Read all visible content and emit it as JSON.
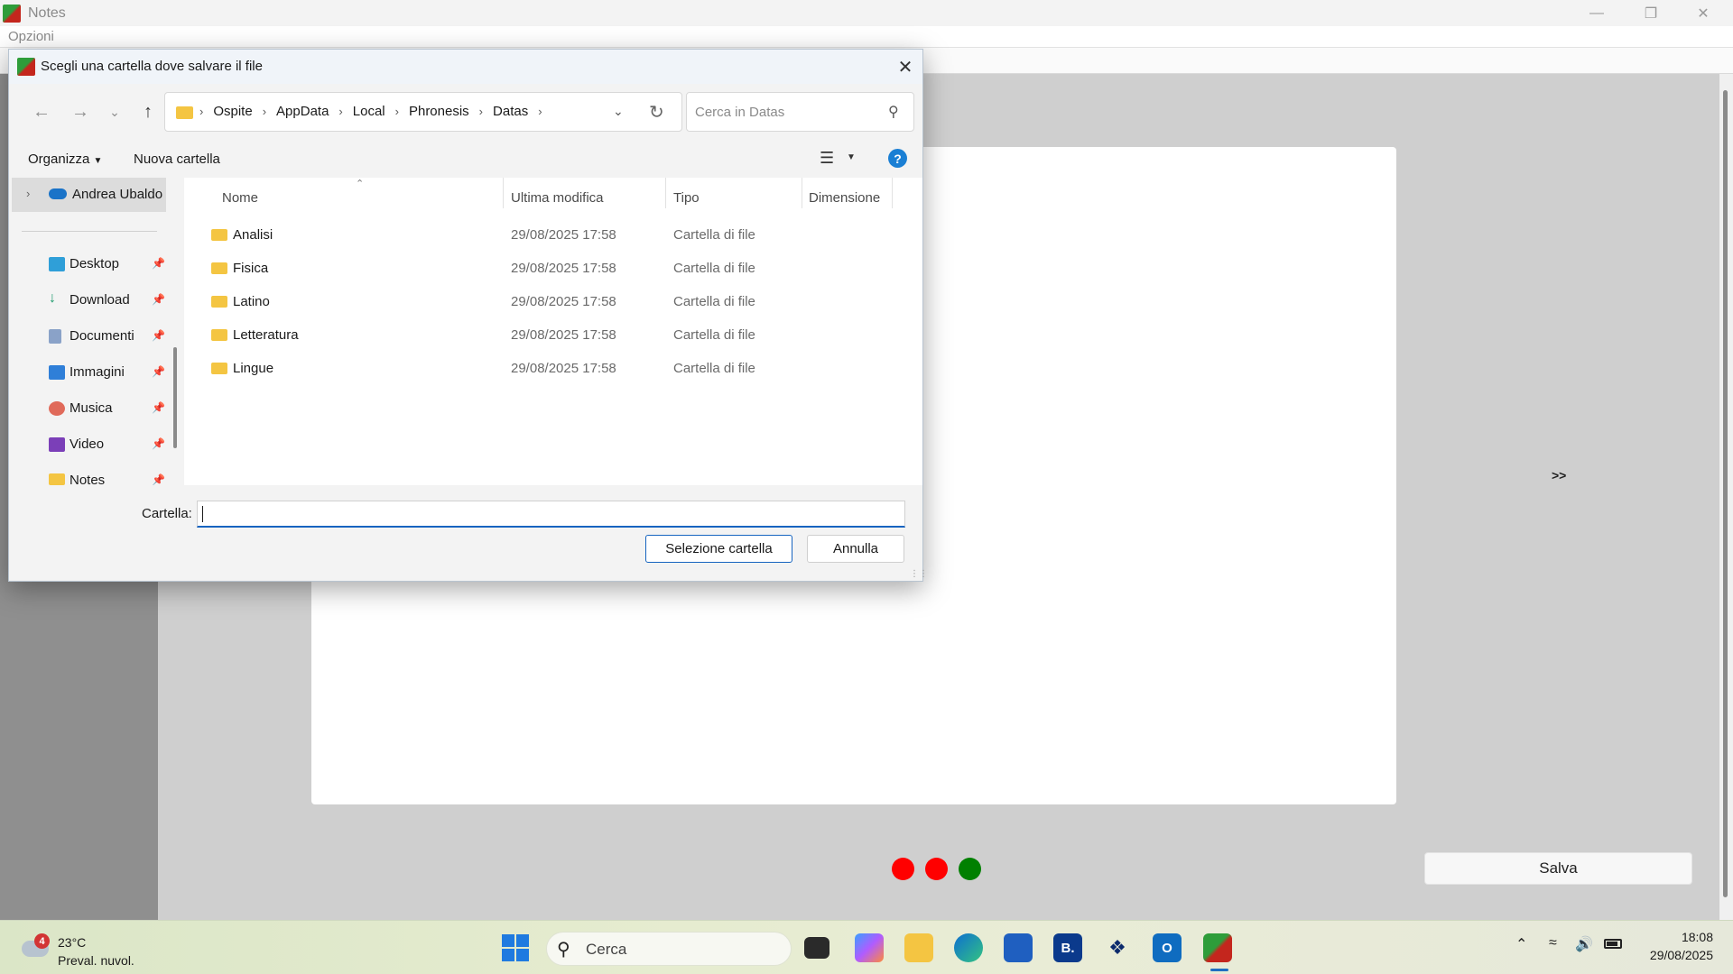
{
  "app": {
    "title": "Notes",
    "menu": [
      "Opzioni"
    ],
    "next_label": ">>",
    "save_label": "Salva",
    "dot_colors": [
      "#ff0000",
      "#ff0000",
      "#008000"
    ]
  },
  "dialog": {
    "title": "Scegli una cartella dove salvare il file",
    "breadcrumb": [
      "Ospite",
      "AppData",
      "Local",
      "Phronesis",
      "Datas"
    ],
    "search_placeholder": "Cerca in Datas",
    "toolbar": {
      "organize": "Organizza",
      "new_folder": "Nuova cartella"
    },
    "nav": {
      "onedrive": "Andrea Ubaldo",
      "items": [
        {
          "label": "Desktop",
          "icon": "desktop-icon"
        },
        {
          "label": "Download",
          "icon": "download-icon"
        },
        {
          "label": "Documenti",
          "icon": "documents-icon"
        },
        {
          "label": "Immagini",
          "icon": "pictures-icon"
        },
        {
          "label": "Musica",
          "icon": "music-icon"
        },
        {
          "label": "Video",
          "icon": "video-icon"
        },
        {
          "label": "Notes",
          "icon": "folder-icon"
        }
      ]
    },
    "columns": [
      "Nome",
      "Ultima modifica",
      "Tipo",
      "Dimensione"
    ],
    "files": [
      {
        "name": "Analisi",
        "modified": "29/08/2025 17:58",
        "type": "Cartella di file"
      },
      {
        "name": "Fisica",
        "modified": "29/08/2025 17:58",
        "type": "Cartella di file"
      },
      {
        "name": "Latino",
        "modified": "29/08/2025 17:58",
        "type": "Cartella di file"
      },
      {
        "name": "Letteratura",
        "modified": "29/08/2025 17:58",
        "type": "Cartella di file"
      },
      {
        "name": "Lingue",
        "modified": "29/08/2025 17:58",
        "type": "Cartella di file"
      }
    ],
    "folder_label": "Cartella:",
    "folder_value": "",
    "select_button": "Selezione cartella",
    "cancel_button": "Annulla"
  },
  "taskbar": {
    "weather": {
      "badge": "4",
      "temp": "23°C",
      "desc": "Preval. nuvol."
    },
    "search_label": "Cerca",
    "apps": [
      "task-view-icon",
      "copilot-icon",
      "file-explorer-icon",
      "edge-icon",
      "store-icon",
      "booking-icon",
      "dropbox-icon",
      "outlook-icon",
      "notes-app-icon"
    ],
    "time": "18:08",
    "date": "29/08/2025"
  }
}
